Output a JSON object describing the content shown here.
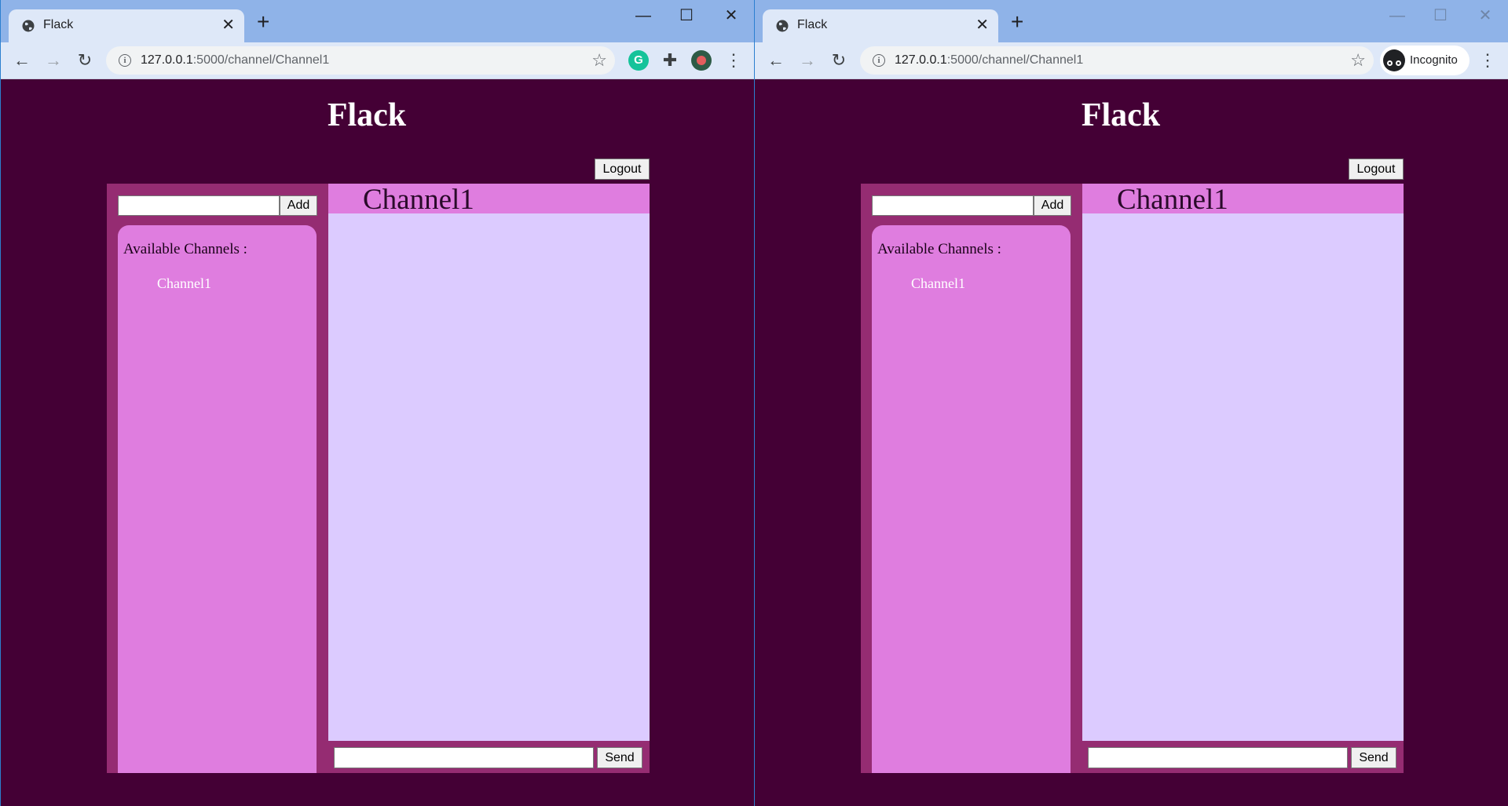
{
  "browser": {
    "tab_title": "Flack",
    "new_tab_glyph": "+",
    "url_host": "127.0.0.1",
    "url_path": ":5000/channel/Channel1",
    "incognito_label": "Incognito"
  },
  "app": {
    "title": "Flack",
    "logout_label": "Logout",
    "add_label": "Add",
    "channels_heading": "Available Channels :",
    "channels": [
      "Channel1"
    ],
    "current_channel": "Channel1",
    "send_label": "Send"
  },
  "icons": {
    "favicon": "globe-icon",
    "back": "back-arrow-icon",
    "forward": "forward-arrow-icon",
    "reload": "reload-icon",
    "site_info": "info-icon",
    "bookmark": "star-icon",
    "extensions": [
      "grammarly-icon",
      "puzzle-icon",
      "profile-avatar-icon"
    ],
    "incognito": "incognito-icon",
    "menu": "kebab-menu-icon"
  },
  "colors": {
    "page_background": "#440035",
    "container": "#952c72",
    "panel": "#df7ddf",
    "messages": "#dccbff"
  }
}
